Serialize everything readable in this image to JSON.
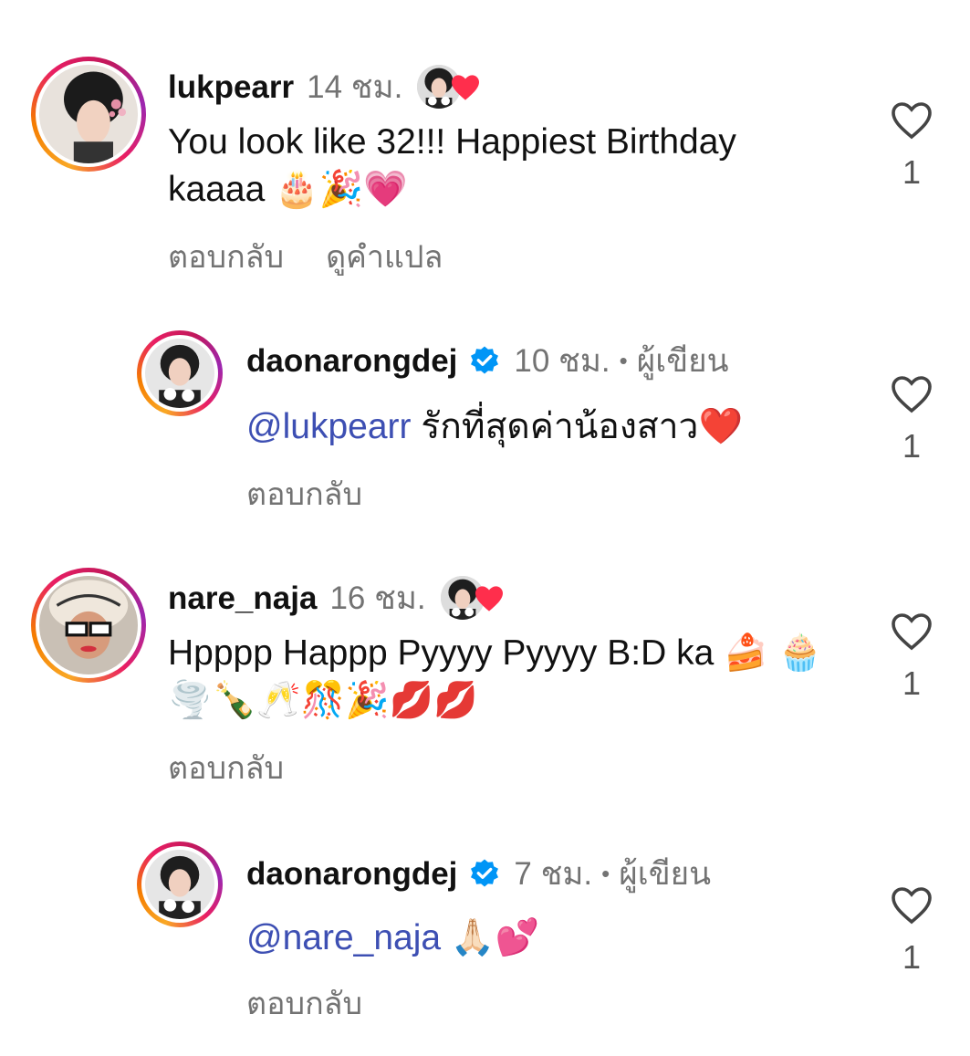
{
  "comments": [
    {
      "username": "lukpearr",
      "time": "14 ชม.",
      "text": "You look like 32!!! Happiest Birthday kaaaa 🎂🎉💗",
      "actions": [
        "ตอบกลับ",
        "ดูคำแปล"
      ],
      "likes": "1",
      "liked_by_author": true,
      "heart_color": "#ff2e4c"
    },
    {
      "username": "daonarongdej",
      "verified": true,
      "time": "10 ชม.",
      "separator": "•",
      "author_label": "ผู้เขียน",
      "mention": "@lukpearr",
      "text": "รักที่สุดค่าน้องสาว❤️",
      "actions": [
        "ตอบกลับ"
      ],
      "likes": "1"
    },
    {
      "username": "nare_naja",
      "time": "16 ชม.",
      "text": "Hpppp Happp Pyyyy Pyyyy B:D ka 🍰 🧁🌪️🍾🥂🎊🎉💋💋",
      "actions": [
        "ตอบกลับ"
      ],
      "likes": "1",
      "liked_by_author": true,
      "heart_color": "#ff2e4c"
    },
    {
      "username": "daonarongdej",
      "verified": true,
      "time": "7 ชม.",
      "separator": "•",
      "author_label": "ผู้เขียน",
      "mention": "@nare_naja",
      "text": "🙏🏻💕",
      "actions": [
        "ตอบกลับ"
      ],
      "likes": "1"
    }
  ],
  "colors": {
    "mention": "#3d4fb3",
    "secondary_text": "#737373",
    "verified_badge": "#0095f6"
  }
}
